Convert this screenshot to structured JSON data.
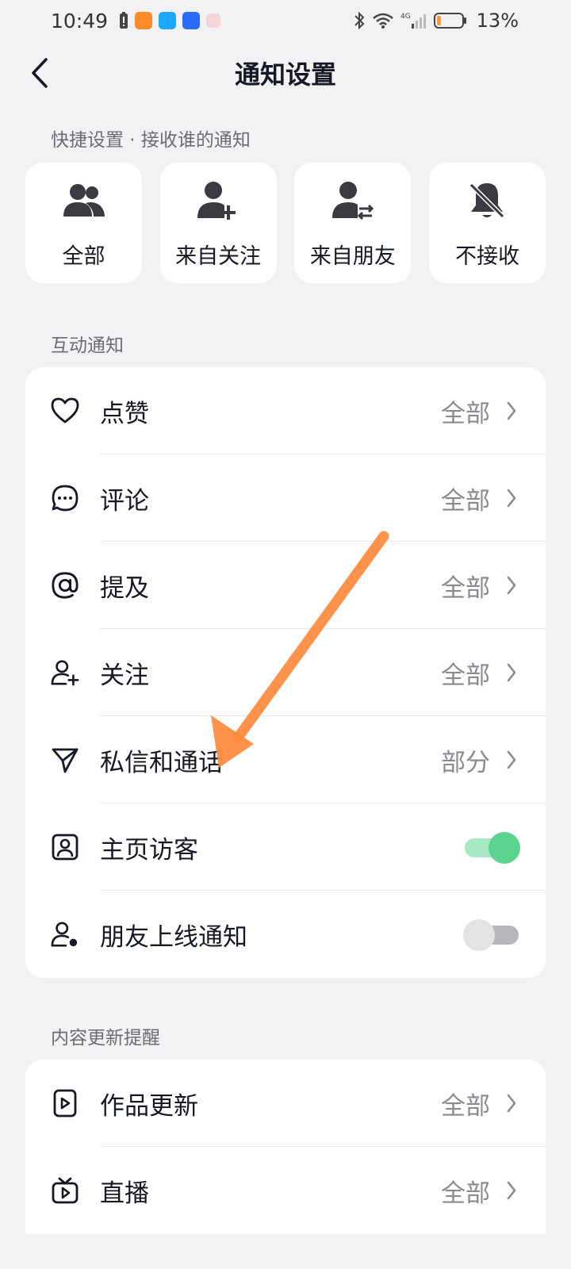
{
  "status_bar": {
    "time": "10:49",
    "network": "4G",
    "battery_percent": "13%",
    "battery_level": 0.13
  },
  "header": {
    "title": "通知设置"
  },
  "quick_settings": {
    "label": "快捷设置 · 接收谁的通知",
    "options": [
      {
        "label": "全部",
        "icon": "people-icon"
      },
      {
        "label": "来自关注",
        "icon": "user-add-icon"
      },
      {
        "label": "来自朋友",
        "icon": "user-swap-icon"
      },
      {
        "label": "不接收",
        "icon": "bell-off-icon"
      }
    ]
  },
  "interaction": {
    "label": "互动通知",
    "items": [
      {
        "label": "点赞",
        "value": "全部",
        "icon": "heart-icon"
      },
      {
        "label": "评论",
        "value": "全部",
        "icon": "comment-icon"
      },
      {
        "label": "提及",
        "value": "全部",
        "icon": "at-icon"
      },
      {
        "label": "关注",
        "value": "全部",
        "icon": "follow-icon"
      },
      {
        "label": "私信和通话",
        "value": "部分",
        "icon": "send-icon"
      },
      {
        "label": "主页访客",
        "toggle": true,
        "icon": "profile-card-icon"
      },
      {
        "label": "朋友上线通知",
        "toggle": false,
        "icon": "friend-online-icon"
      }
    ]
  },
  "content_updates": {
    "label": "内容更新提醒",
    "items": [
      {
        "label": "作品更新",
        "value": "全部",
        "icon": "video-icon"
      },
      {
        "label": "直播",
        "value": "全部",
        "icon": "tv-icon"
      }
    ]
  },
  "colors": {
    "toggle_on": "#5bd48f",
    "annotation_arrow": "#ff8a3d",
    "background": "#f2f2f4"
  }
}
